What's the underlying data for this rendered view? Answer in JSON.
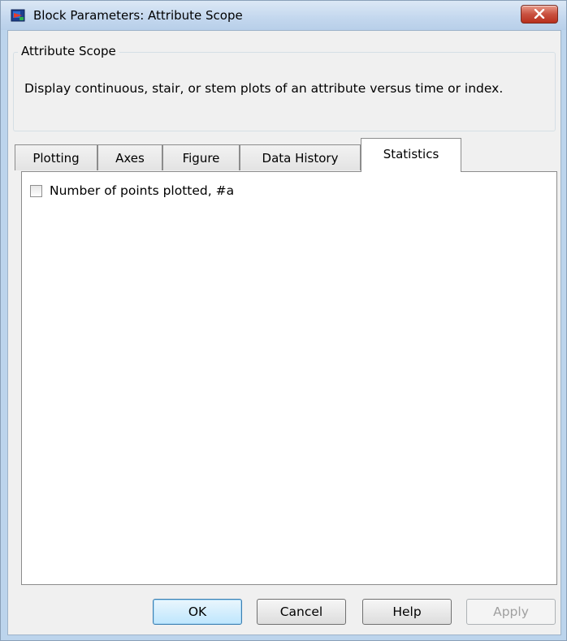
{
  "window": {
    "title": "Block Parameters: Attribute Scope",
    "title_icon": "simulink-block-icon",
    "close_icon": "close-x-icon"
  },
  "group": {
    "label": "Attribute Scope",
    "description": "Display continuous, stair, or stem plots of an attribute versus time or index."
  },
  "tabs": [
    {
      "label": "Plotting",
      "active": false
    },
    {
      "label": "Axes",
      "active": false
    },
    {
      "label": "Figure",
      "active": false
    },
    {
      "label": "Data History",
      "active": false
    },
    {
      "label": "Statistics",
      "active": true
    }
  ],
  "statistics": {
    "checkbox_label": "Number of points plotted, #a",
    "checked": false
  },
  "buttons": {
    "ok": "OK",
    "cancel": "Cancel",
    "help": "Help",
    "apply": "Apply",
    "apply_enabled": false
  },
  "colors": {
    "frame": "#bcd4ec",
    "client": "#f0f0f0",
    "close": "#c95140"
  }
}
